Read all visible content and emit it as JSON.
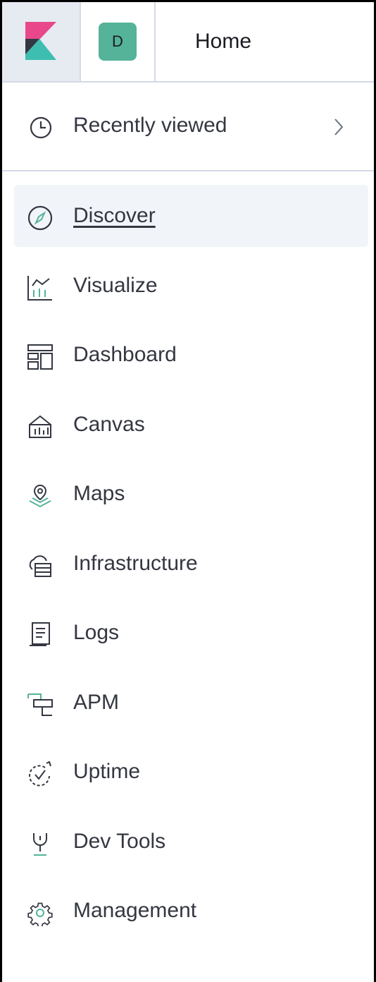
{
  "header": {
    "space_initial": "D",
    "breadcrumb": "Home"
  },
  "recent": {
    "label": "Recently viewed",
    "icon": "clock-icon"
  },
  "nav": {
    "items": [
      {
        "label": "Discover",
        "icon": "compass-icon",
        "active": true
      },
      {
        "label": "Visualize",
        "icon": "visualize-icon"
      },
      {
        "label": "Dashboard",
        "icon": "dashboard-icon"
      },
      {
        "label": "Canvas",
        "icon": "canvas-icon"
      },
      {
        "label": "Maps",
        "icon": "map-pin-icon"
      },
      {
        "label": "Infrastructure",
        "icon": "infrastructure-icon"
      },
      {
        "label": "Logs",
        "icon": "logs-icon"
      },
      {
        "label": "APM",
        "icon": "apm-icon"
      },
      {
        "label": "Uptime",
        "icon": "uptime-icon"
      },
      {
        "label": "Dev Tools",
        "icon": "dev-tools-icon"
      },
      {
        "label": "Management",
        "icon": "gear-icon"
      }
    ]
  },
  "colors": {
    "accent_teal": "#54b399",
    "logo_pink": "#e8488b",
    "logo_teal": "#3ebeb0",
    "logo_dark": "#343741",
    "active_bg": "#f1f4f9"
  }
}
